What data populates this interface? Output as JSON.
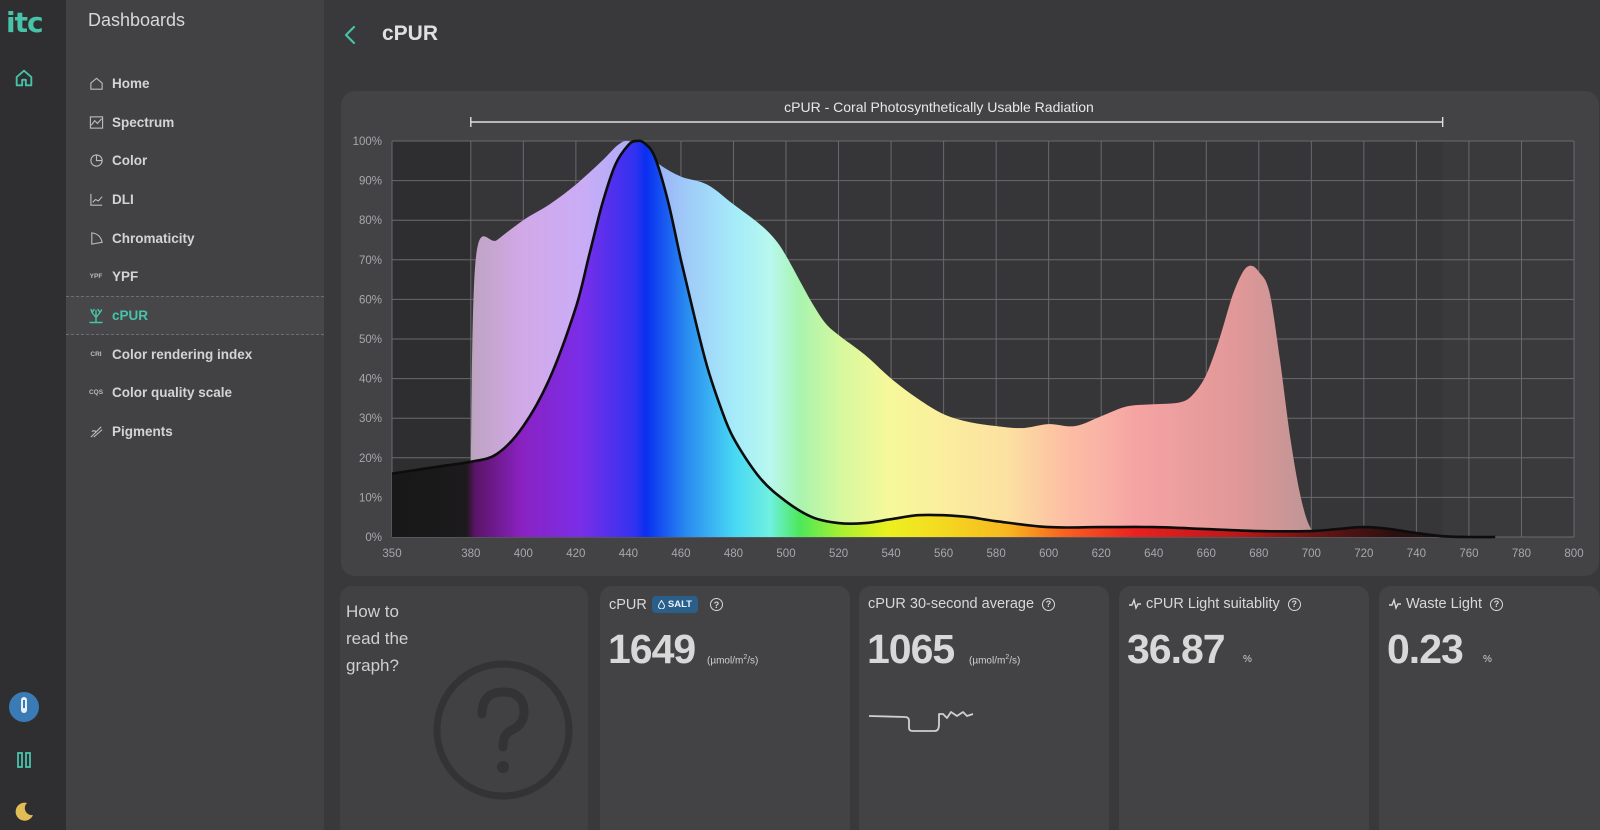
{
  "app": {
    "logo": "itc"
  },
  "sidebar": {
    "heading": "Dashboards",
    "items": [
      {
        "label": "Home",
        "icon": "home-icon",
        "active": false
      },
      {
        "label": "Spectrum",
        "icon": "spectrum-icon",
        "active": false
      },
      {
        "label": "Color",
        "icon": "color-icon",
        "active": false
      },
      {
        "label": "DLI",
        "icon": "dli-icon",
        "active": false
      },
      {
        "label": "Chromaticity",
        "icon": "chromaticity-icon",
        "active": false
      },
      {
        "label": "YPF",
        "icon": "ypf-icon",
        "active": false
      },
      {
        "label": "cPUR",
        "icon": "coral-icon",
        "active": true
      },
      {
        "label": "Color rendering index",
        "icon": "cri-icon",
        "active": false
      },
      {
        "label": "Color quality scale",
        "icon": "cqs-icon",
        "active": false
      },
      {
        "label": "Pigments",
        "icon": "pigments-icon",
        "active": false
      }
    ],
    "icon_labels": {
      "ypf": "YPF",
      "cri": "CRI",
      "cqs": "CQS"
    }
  },
  "header": {
    "title": "cPUR"
  },
  "chart_data": {
    "type": "area",
    "title": "cPUR - Coral Photosynthetically Usable Radiation",
    "xlim": [
      350,
      800
    ],
    "ylim": [
      0,
      100
    ],
    "x_ticks": [
      350,
      380,
      400,
      420,
      440,
      460,
      480,
      500,
      520,
      540,
      560,
      580,
      600,
      620,
      640,
      660,
      680,
      700,
      720,
      740,
      760,
      780,
      800
    ],
    "y_ticks": [
      "0%",
      "10%",
      "20%",
      "30%",
      "40%",
      "50%",
      "60%",
      "70%",
      "80%",
      "90%",
      "100%"
    ],
    "bracket_range": [
      380,
      750
    ],
    "grid": true,
    "series": [
      {
        "fill": "spectral",
        "x": [
          380,
          382,
          390,
          400,
          410,
          420,
          430,
          436,
          440,
          445,
          452,
          460,
          470,
          480,
          490,
          496,
          500,
          505,
          510,
          515,
          520,
          530,
          540,
          550,
          560,
          570,
          580,
          590,
          600,
          610,
          620,
          630,
          640,
          650,
          655,
          660,
          665,
          670,
          674,
          677,
          680,
          684,
          688,
          692,
          696,
          700,
          705,
          710,
          720,
          730,
          740,
          750,
          760
        ],
        "values": [
          20,
          71,
          75,
          80,
          84,
          89,
          95,
          99,
          100,
          98,
          94,
          91,
          89,
          84,
          79,
          75,
          71,
          65,
          59,
          54,
          51,
          46,
          40,
          35,
          31,
          29,
          28,
          27.5,
          28.5,
          28,
          30.5,
          33,
          33.5,
          34,
          36,
          41,
          50,
          61,
          67,
          68.5,
          67,
          62,
          45,
          25,
          10,
          2,
          1,
          0.5,
          0.5,
          0.5,
          0.3,
          0.2,
          0
        ]
      },
      {
        "line": true,
        "x": [
          350,
          360,
          370,
          380,
          390,
          400,
          410,
          420,
          425,
          430,
          435,
          440,
          443,
          446,
          450,
          455,
          460,
          465,
          470,
          475,
          480,
          490,
          500,
          510,
          520,
          530,
          540,
          550,
          560,
          570,
          580,
          600,
          620,
          640,
          660,
          680,
          700,
          710,
          720,
          730,
          740,
          750,
          760,
          770
        ],
        "values": [
          16,
          17,
          18,
          19,
          21,
          28,
          40,
          58,
          71,
          84,
          94,
          99,
          100,
          99.5,
          96,
          85,
          70,
          56,
          43,
          33,
          25,
          15,
          9,
          5,
          3.5,
          3.5,
          4.5,
          5.5,
          5.5,
          5,
          4,
          2.5,
          2.5,
          2.5,
          2,
          1.5,
          1.5,
          2,
          2.5,
          2,
          1,
          0.2,
          0,
          0
        ]
      }
    ]
  },
  "cards": {
    "howto": {
      "text": "How to read the graph?"
    },
    "cpur": {
      "title": "cPUR",
      "badge": "SALT",
      "value": "1649",
      "unit_prefix": "(µmol/m",
      "unit_exp": "2",
      "unit_suffix": "/s)"
    },
    "avg": {
      "title": "cPUR 30-second average",
      "value": "1065",
      "unit_prefix": "(µmol/m",
      "unit_exp": "2",
      "unit_suffix": "/s)"
    },
    "suitability": {
      "title": "cPUR Light suitablity",
      "value": "36.87",
      "unit": "%"
    },
    "waste": {
      "title": "Waste Light",
      "value": "0.23",
      "unit": "%"
    }
  },
  "colors": {
    "accent": "#47c3a9",
    "badge": "#2a5f8a"
  }
}
